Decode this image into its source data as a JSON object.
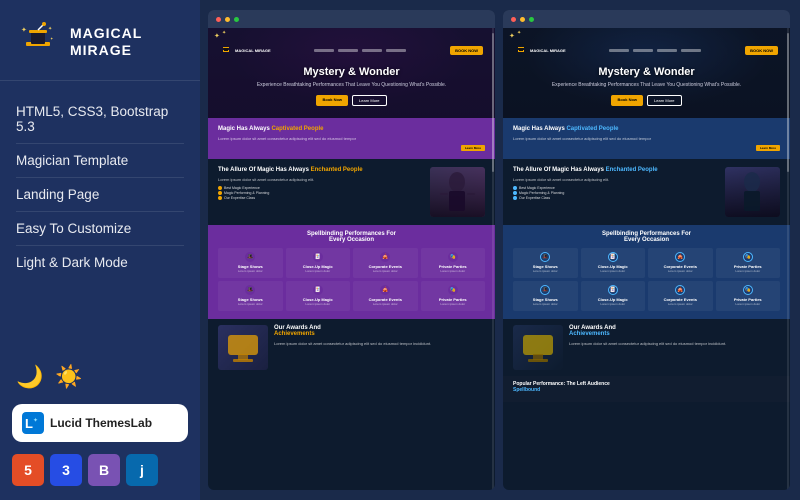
{
  "sidebar": {
    "logo": {
      "name": "MAGICAL\nMIRAGE"
    },
    "features": [
      "HTML5, CSS3, Bootstrap 5.3",
      "Magician Template",
      "Landing Page",
      "Easy To Customize",
      "Light & Dark Mode"
    ],
    "modes": {
      "dark_icon": "🌙",
      "light_icon": "☀️"
    },
    "lucid": {
      "label": "Lucid ThemesLab"
    },
    "tech": [
      {
        "label": "5",
        "type": "html"
      },
      {
        "label": "3",
        "type": "css"
      },
      {
        "label": "B",
        "type": "bootstrap"
      },
      {
        "label": "j",
        "type": "jquery"
      }
    ]
  },
  "preview_left": {
    "hero": {
      "title": "Mystery & Wonder",
      "subtitle": "Experience Breathtaking Performances That\nLeave You Questioning What's Possible.",
      "btn_primary": "Book Now",
      "btn_secondary": "Learn More"
    },
    "sections": [
      {
        "type": "purple",
        "title": "Magic Has Always Captivated People"
      },
      {
        "type": "dark",
        "title": "The Allure Of Magic Has\nAlways Enchanted People",
        "checklist": [
          "Best Magic Experience",
          "Magic Performing & Planning",
          "Our Expertise Class"
        ]
      },
      {
        "type": "purple-grid",
        "title": "Spellbinding Performances For\nEvery Occasion",
        "cards": [
          {
            "icon": "🎩",
            "title": "Stage Shows"
          },
          {
            "icon": "🃏",
            "title": "Close-Up Magic"
          },
          {
            "icon": "🎪",
            "title": "Corporate Events"
          },
          {
            "icon": "🎭",
            "title": "Private Parties"
          },
          {
            "icon": "🎩",
            "title": "Stage Shows"
          },
          {
            "icon": "🃏",
            "title": "Close-Up Magic"
          },
          {
            "icon": "🎪",
            "title": "Corporate Events"
          },
          {
            "icon": "🎭",
            "title": "Private Parties"
          }
        ]
      },
      {
        "type": "dark",
        "title": "Our Awards And\nAchievements"
      }
    ]
  },
  "preview_right": {
    "hero": {
      "title": "Mystery & Wonder",
      "subtitle": "Experience Breathtaking Performances That\nLeave You Questioning What's Possible."
    },
    "sections": [
      {
        "type": "blue",
        "title": "Magic Has Always Captivated People"
      },
      {
        "type": "dark",
        "title": "The Allure Of Magic Has\nAlways Enchanted People",
        "checklist": [
          "Best Magic Experience",
          "Magic Performing & Planning",
          "Our Expertise Class"
        ]
      },
      {
        "type": "blue-grid",
        "title": "Spellbinding Performances For\nEvery Occasion"
      },
      {
        "type": "dark",
        "title": "Our Awards And\nAchievements"
      },
      {
        "type": "dark",
        "title": "Popular Performance: The Left Audience\nSpellbound"
      }
    ]
  }
}
